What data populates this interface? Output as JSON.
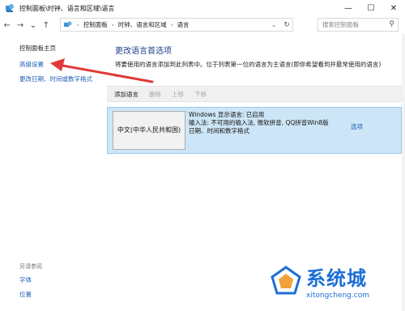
{
  "window": {
    "title": "控制面板\\时钟、语言和区域\\语言",
    "minimize_glyph": "—",
    "maximize_glyph": "☐",
    "close_glyph": "✕"
  },
  "nav": {
    "back": "←",
    "forward": "→",
    "history": "⌄",
    "up": "↑"
  },
  "address": {
    "crumbs": [
      "控制面板",
      "时钟、语言和区域",
      "语言"
    ],
    "separator": "›",
    "dropdown_glyph": "⌄",
    "refresh_glyph": "↻"
  },
  "search": {
    "placeholder": "搜索控制面板",
    "icon": "search-icon",
    "glyph": "⚲"
  },
  "sidebar": {
    "home": "控制面板主页",
    "items": [
      "高级设置",
      "更改日期、时间或数字格式"
    ],
    "see_also_label": "另请参阅",
    "see_also_items": [
      "字体",
      "位置"
    ]
  },
  "main": {
    "title": "更改语言首选项",
    "description": "将要使用的语言添加到此列表中。位于列表第一位的语言为主语言(即你希望看到并最常使用的语言)",
    "bullet": "。"
  },
  "toolbar": {
    "add": "添加语言",
    "remove": "删除",
    "up": "上移",
    "down": "下移"
  },
  "language_entry": {
    "name": "中文(中华人民共和国)",
    "details": [
      "Windows 显示语言: 已启用",
      "输入法: 不可用的输入法, 微软拼音, QQ拼音Win8版",
      "日期、时间和数字格式"
    ],
    "options_link": "选项"
  },
  "watermark": {
    "title": "系统城",
    "url": "xitongcheng.com"
  },
  "colors": {
    "accent_blue": "#1d5bb8",
    "selected_row": "#cde6f7",
    "annotation_arrow": "#e03a3a",
    "watermark": "#1c6fd6"
  }
}
